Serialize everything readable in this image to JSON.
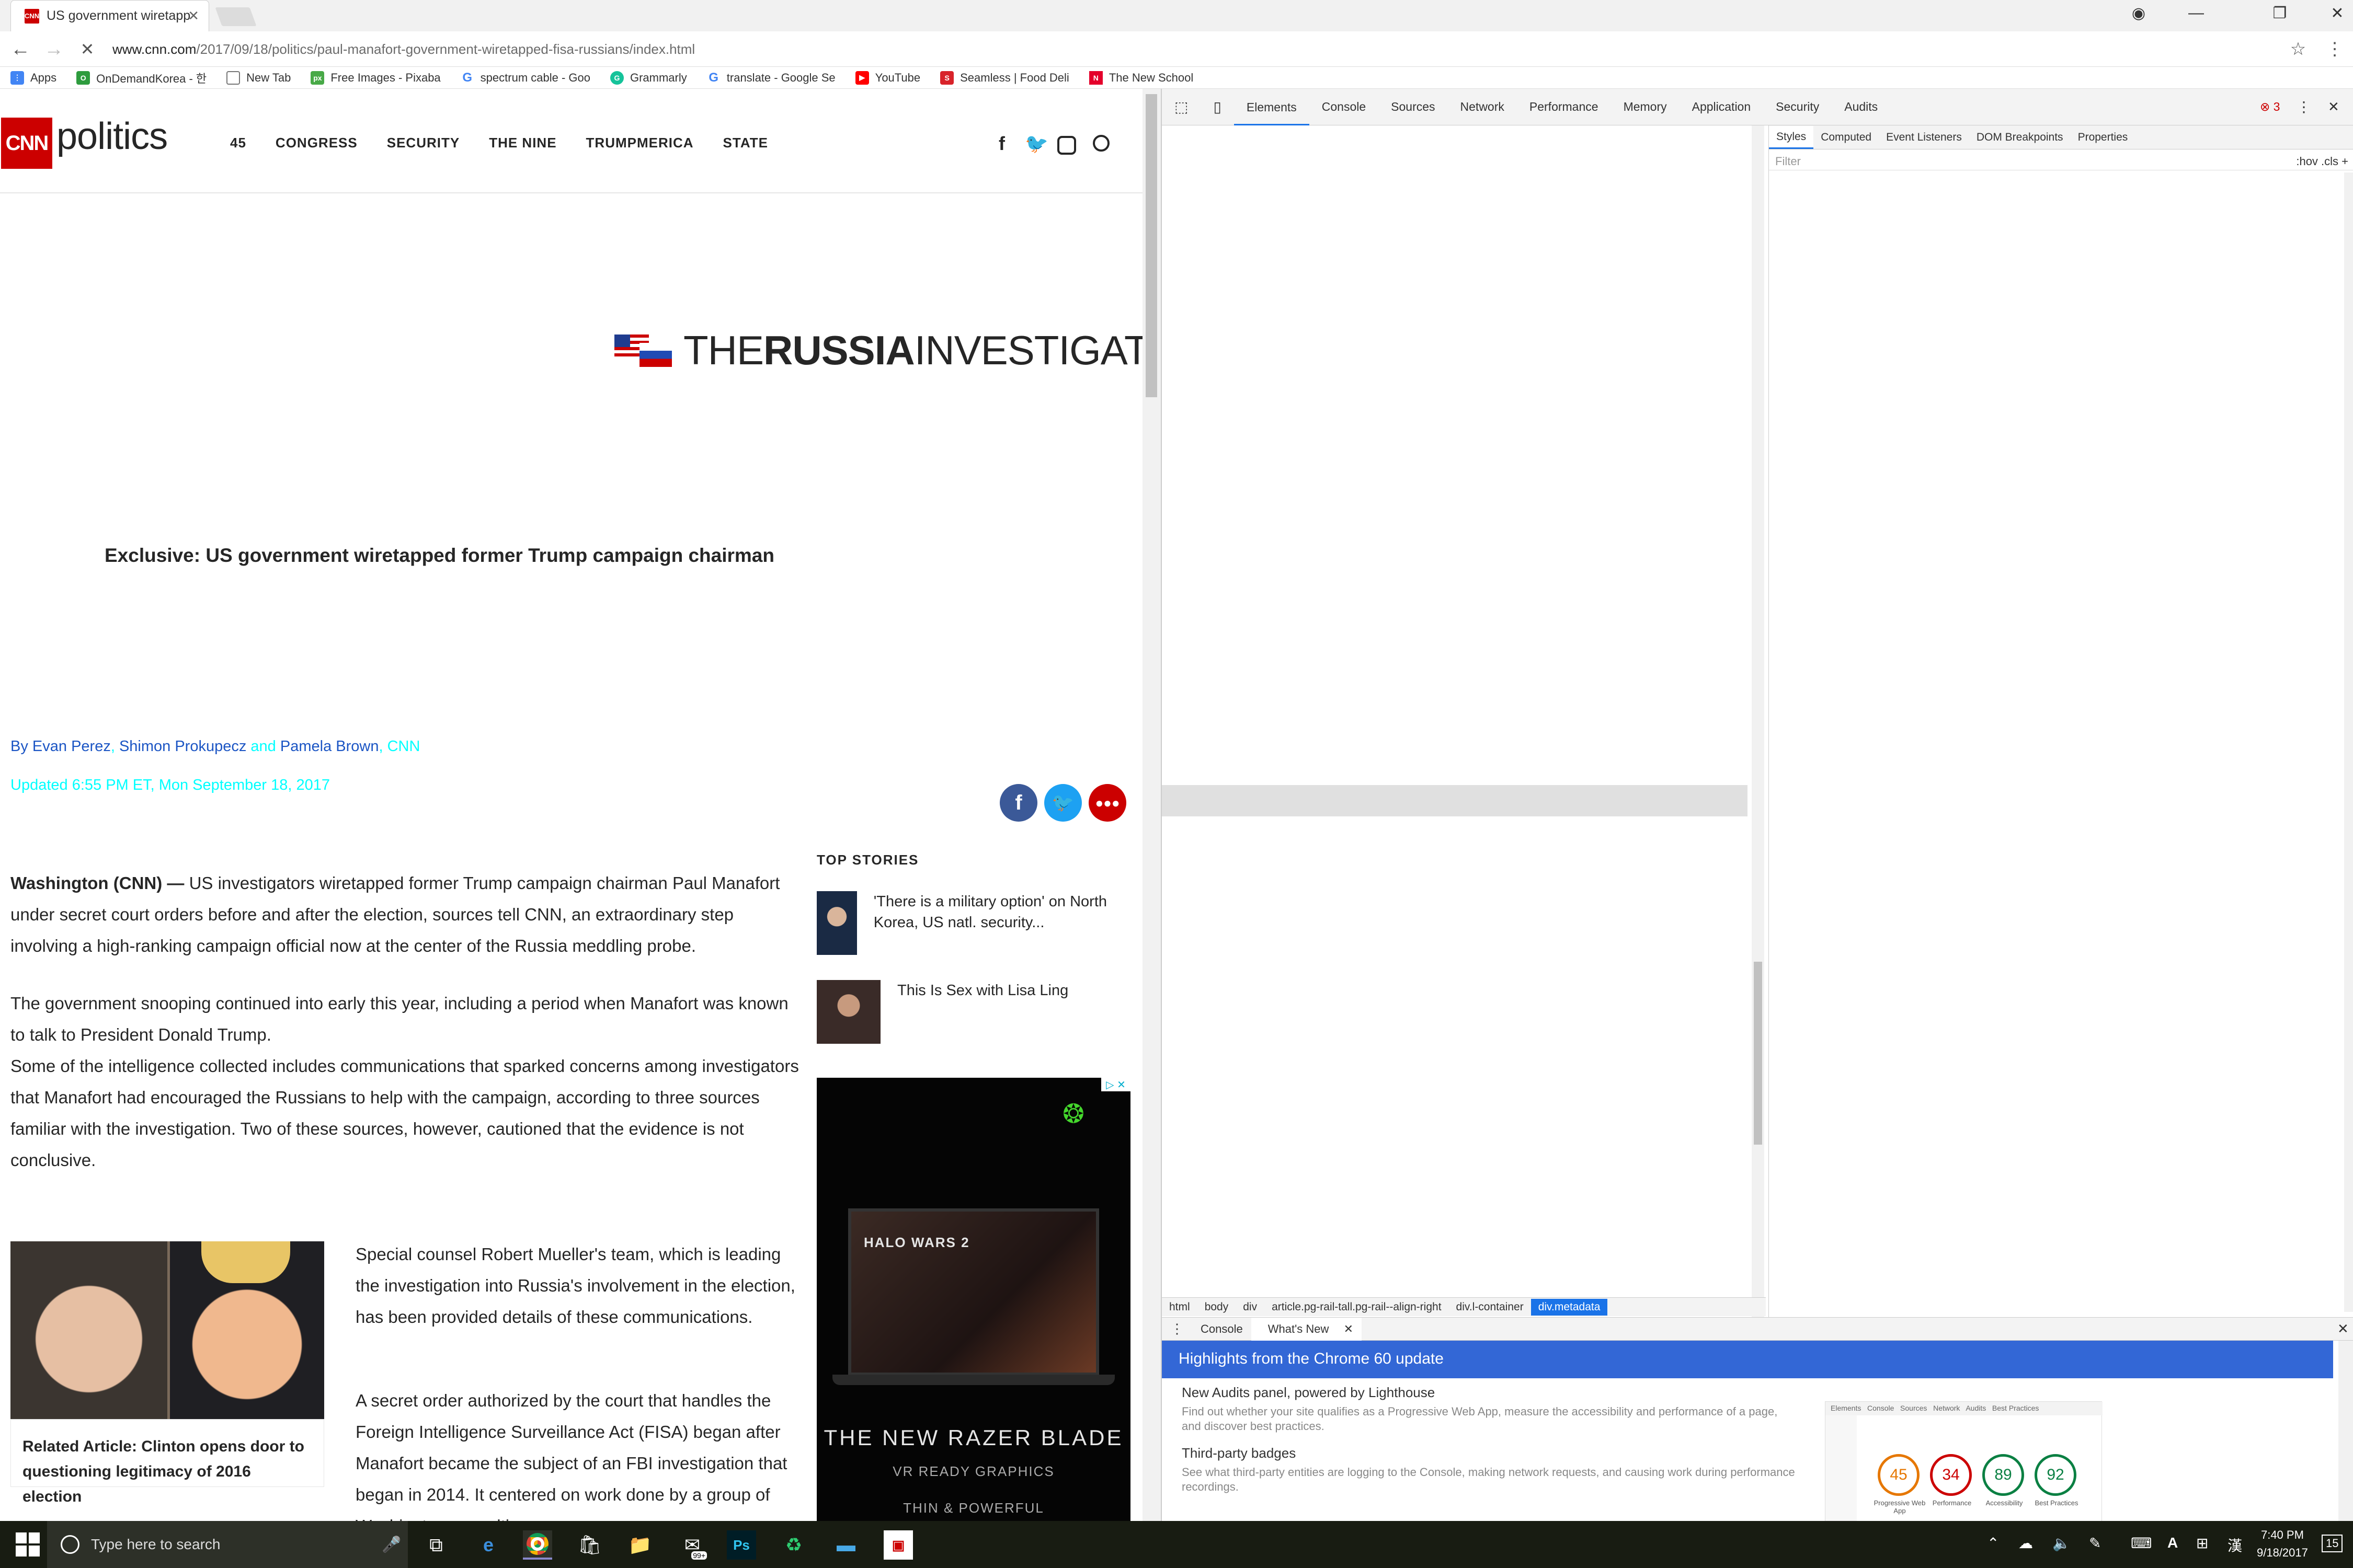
{
  "browser": {
    "tab_title": "US government wiretapp",
    "url_host": "www.cnn.com",
    "url_path": "/2017/09/18/politics/paul-manafort-government-wiretapped-fisa-russians/index.html",
    "bookmarks": [
      {
        "label": "Apps",
        "color": "#4285f4"
      },
      {
        "label": "OnDemandKorea - 한",
        "color": "#2e9c3e"
      },
      {
        "label": "New Tab",
        "color": "#777777"
      },
      {
        "label": "Free Images - Pixaba",
        "color": "#48a947"
      },
      {
        "label": "spectrum cable - Goo",
        "color": "#4285f4"
      },
      {
        "label": "Grammarly",
        "color": "#15c39a"
      },
      {
        "label": "translate - Google Se",
        "color": "#4285f4"
      },
      {
        "label": "YouTube",
        "color": "#ff0000"
      },
      {
        "label": "Seamless | Food Deli",
        "color": "#d8232a"
      },
      {
        "label": "The New School",
        "color": "#e4002b"
      }
    ]
  },
  "cnn": {
    "logo": "CNN",
    "section": "politics",
    "nav": [
      "45",
      "CONGRESS",
      "SECURITY",
      "THE NINE",
      "TRUMPMERICA",
      "STATE"
    ],
    "russia_the": "THE",
    "russia_bold": "RUSSIA",
    "russia_rest": "INVESTIGATION",
    "headline": "Exclusive: US government wiretapped former Trump campaign chairman",
    "by": "By",
    "author1": "Evan Perez",
    "author2": "Shimon Prokupecz",
    "and": "and",
    "author3": "Pamela Brown",
    "source": "CNN",
    "updated": "Updated 6:55 PM ET, Mon September 18, 2017",
    "dateline": "Washington (CNN) —",
    "p1": "US investigators wiretapped former Trump campaign chairman Paul Manafort under secret court orders before and after the election, sources tell CNN, an extraordinary step involving a high-ranking campaign official now at the center of the Russia meddling probe.",
    "p2": "The government snooping continued into early this year, including a period when Manafort was known to talk to President Donald Trump.",
    "p3": "Some of the intelligence collected includes communications that sparked concerns among investigators that Manafort had encouraged the Russians to help with the campaign, according to three sources familiar with the investigation. Two of these sources, however, cautioned that the evidence is not conclusive.",
    "p4": "Special counsel Robert Mueller's team, which is leading the investigation into Russia's involvement in the election, has been provided details of these communications.",
    "p5": "A secret order authorized by the court that handles the Foreign Intelligence Surveillance Act (FISA) began after Manafort became the subject of an FBI investigation that began in 2014. It centered on work done by a group of Washington consulting",
    "related_label": "Related Article:",
    "related_text": "Clinton opens door to questioning legitimacy of 2016 election",
    "top_stories": "TOP STORIES",
    "story1": "'There is a military option' on North Korea, US natl. security...",
    "story2": "This Is Sex with Lisa Ling",
    "ad_game": "HALO WARS 2",
    "ad_title": "THE NEW RAZER BLADE",
    "ad_line1": "VR READY GRAPHICS",
    "ad_line2": "THIN & POWERFUL"
  },
  "devtools": {
    "tabs": [
      "Elements",
      "Console",
      "Sources",
      "Network",
      "Performance",
      "Memory",
      "Application",
      "Security",
      "Audits"
    ],
    "error_count": "3",
    "style_tabs": [
      "Styles",
      "Computed",
      "Event Listeners",
      "DOM Breakpoints",
      "Properties"
    ],
    "filter_placeholder": "Filter",
    "filter_right": ":hov  .cls  +",
    "breadcrumbs": [
      "html",
      "body",
      "div",
      "article.pg-rail-tall.pg-rail--align-right",
      "div.l-container",
      "div.metadata"
    ],
    "drawer_tabs": [
      "Console",
      "What's New"
    ],
    "highlights": "Highlights from the Chrome 60 update",
    "whatsnew1_title": "New Audits panel, powered by Lighthouse",
    "whatsnew1_desc": "Find out whether your site qualifies as a Progressive Web App, measure the accessibility and performance of a page, and discover best practices.",
    "whatsnew2_title": "Third-party badges",
    "whatsnew2_desc": "See what third-party entities are logging to the Console, making network requests, and causing work during performance recordings.",
    "scores": [
      {
        "value": "45",
        "label": "Progressive Web App",
        "color": "#e67700"
      },
      {
        "value": "34",
        "label": "Performance",
        "color": "#cc0000"
      },
      {
        "value": "89",
        "label": "Accessibility",
        "color": "#0b8043"
      },
      {
        "value": "92",
        "label": "Best Practices",
        "color": "#0b8043"
      }
    ]
  },
  "taskbar": {
    "search_placeholder": "Type here to search",
    "time": "7:40 PM",
    "date": "9/18/2017",
    "notifications": "15",
    "mail_badge": "99+"
  }
}
